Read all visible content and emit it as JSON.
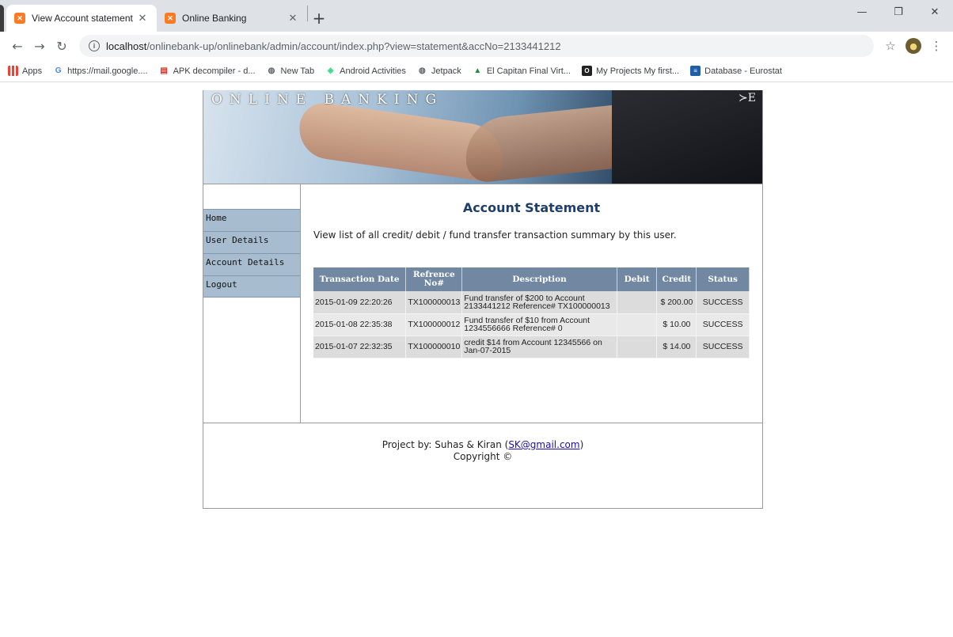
{
  "browser": {
    "tabs": [
      {
        "title": "View Account statement",
        "active": true
      },
      {
        "title": "Online Banking",
        "active": false
      }
    ],
    "new_tab_glyph": "+",
    "url_host": "localhost",
    "url_path": "/onlinebank-up/onlinebank/admin/account/index.php?view=statement&accNo=2133441212",
    "bookmarks": [
      {
        "label": "Apps",
        "icon": "apps-icon"
      },
      {
        "label": "https://mail.google....",
        "icon": "google-icon"
      },
      {
        "label": "APK decompiler - d...",
        "icon": "apk-icon"
      },
      {
        "label": "New Tab",
        "icon": "globe-icon"
      },
      {
        "label": "Android Activities",
        "icon": "android-icon"
      },
      {
        "label": "Jetpack",
        "icon": "globe-icon"
      },
      {
        "label": "El Capitan Final Virt...",
        "icon": "drive-icon"
      },
      {
        "label": "My Projects My first...",
        "icon": "project-icon"
      },
      {
        "label": "Database - Eurostat",
        "icon": "database-icon"
      }
    ]
  },
  "banner": {
    "title": "ONLINE BANKING",
    "mark": "≻E"
  },
  "sidebar": {
    "items": [
      {
        "label": "Home"
      },
      {
        "label": "User Details"
      },
      {
        "label": "Account Details"
      },
      {
        "label": "Logout"
      }
    ]
  },
  "main": {
    "title": "Account Statement",
    "description": "View list of all credit/ debit / fund transfer transaction summary by this user.",
    "table": {
      "headers": [
        "Transaction Date",
        "Refrence No#",
        "Description",
        "Debit",
        "Credit",
        "Status"
      ],
      "rows": [
        [
          "2015-01-09 22:20:26",
          "TX100000013",
          "Fund transfer of $200 to Account 2133441212 Reference# TX100000013",
          "",
          "$ 200.00",
          "SUCCESS"
        ],
        [
          "2015-01-08 22:35:38",
          "TX100000012",
          "Fund transfer of $10 from Account 1234556666 Reference# 0",
          "",
          "$ 10.00",
          "SUCCESS"
        ],
        [
          "2015-01-07 22:32:35",
          "TX100000010",
          "credit $14 from Account 12345566 on Jan-07-2015",
          "",
          "$ 14.00",
          "SUCCESS"
        ]
      ]
    }
  },
  "footer": {
    "project_by": "Project by: Suhas & Kiran (",
    "email": "SK@gmail.com",
    "project_close": ")",
    "copyright": "Copyright ©"
  },
  "colors": {
    "sidebar_bg": "#a7bccf",
    "table_header_bg": "#7187a2",
    "title_color": "#1f3f6a"
  }
}
